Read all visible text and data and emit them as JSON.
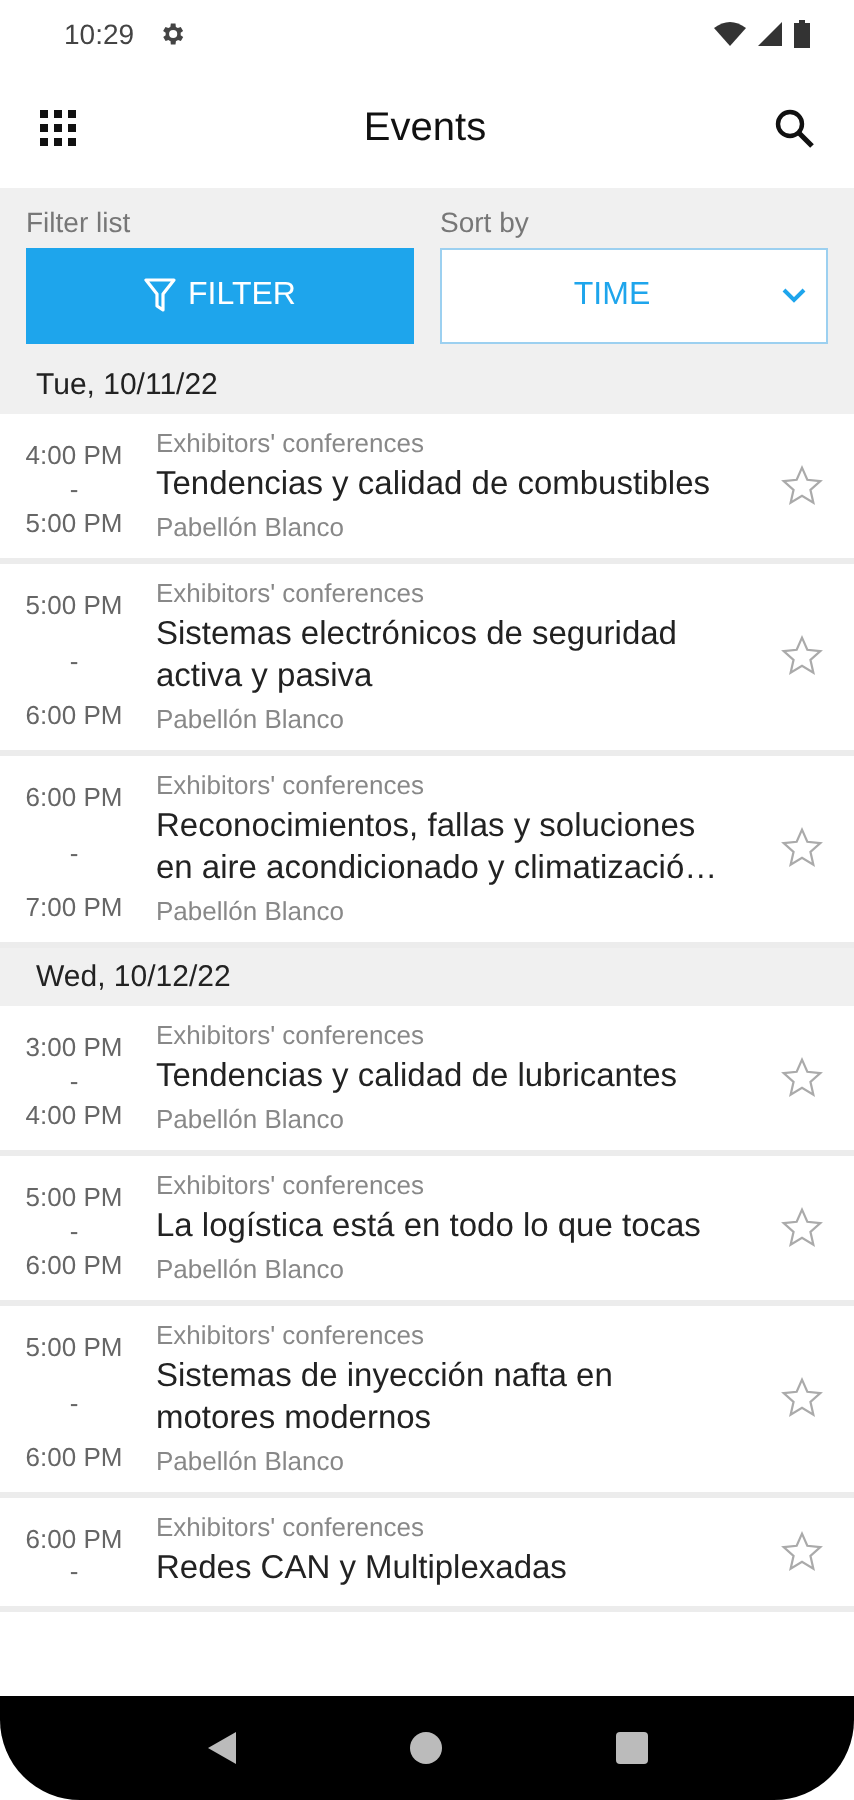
{
  "status_bar": {
    "time": "10:29"
  },
  "app_bar": {
    "title": "Events"
  },
  "filter": {
    "label": "Filter list",
    "button": "FILTER"
  },
  "sort": {
    "label": "Sort by",
    "value": "TIME"
  },
  "days": [
    {
      "date": "Tue, 10/11/22",
      "events": [
        {
          "start": "4:00 PM",
          "separator": "-",
          "end": "5:00 PM",
          "category": "Exhibitors' conferences",
          "title": "Tendencias y calidad de combustibles",
          "location": "Pabellón Blanco",
          "starred": false
        },
        {
          "start": "5:00 PM",
          "separator": "-",
          "end": "6:00 PM",
          "category": "Exhibitors' conferences",
          "title": "Sistemas electrónicos de seguridad activa y pasiva",
          "location": "Pabellón Blanco",
          "starred": false
        },
        {
          "start": "6:00 PM",
          "separator": "-",
          "end": "7:00 PM",
          "category": "Exhibitors' conferences",
          "title": "Reconocimientos, fallas y soluciones en aire acondicionado y climatizació…",
          "location": "Pabellón Blanco",
          "starred": false
        }
      ]
    },
    {
      "date": "Wed, 10/12/22",
      "events": [
        {
          "start": "3:00 PM",
          "separator": "-",
          "end": "4:00 PM",
          "category": "Exhibitors' conferences",
          "title": "Tendencias y calidad de lubricantes",
          "location": "Pabellón Blanco",
          "starred": false
        },
        {
          "start": "5:00 PM",
          "separator": "-",
          "end": "6:00 PM",
          "category": "Exhibitors' conferences",
          "title": "La logística está en todo lo que tocas",
          "location": "Pabellón Blanco",
          "starred": false
        },
        {
          "start": "5:00 PM",
          "separator": "-",
          "end": "6:00 PM",
          "category": "Exhibitors' conferences",
          "title": "Sistemas de inyección nafta en motores modernos",
          "location": "Pabellón Blanco",
          "starred": false
        },
        {
          "start": "6:00 PM",
          "separator": "-",
          "category": "Exhibitors' conferences",
          "title": "Redes CAN y Multiplexadas",
          "starred": false
        }
      ]
    }
  ]
}
